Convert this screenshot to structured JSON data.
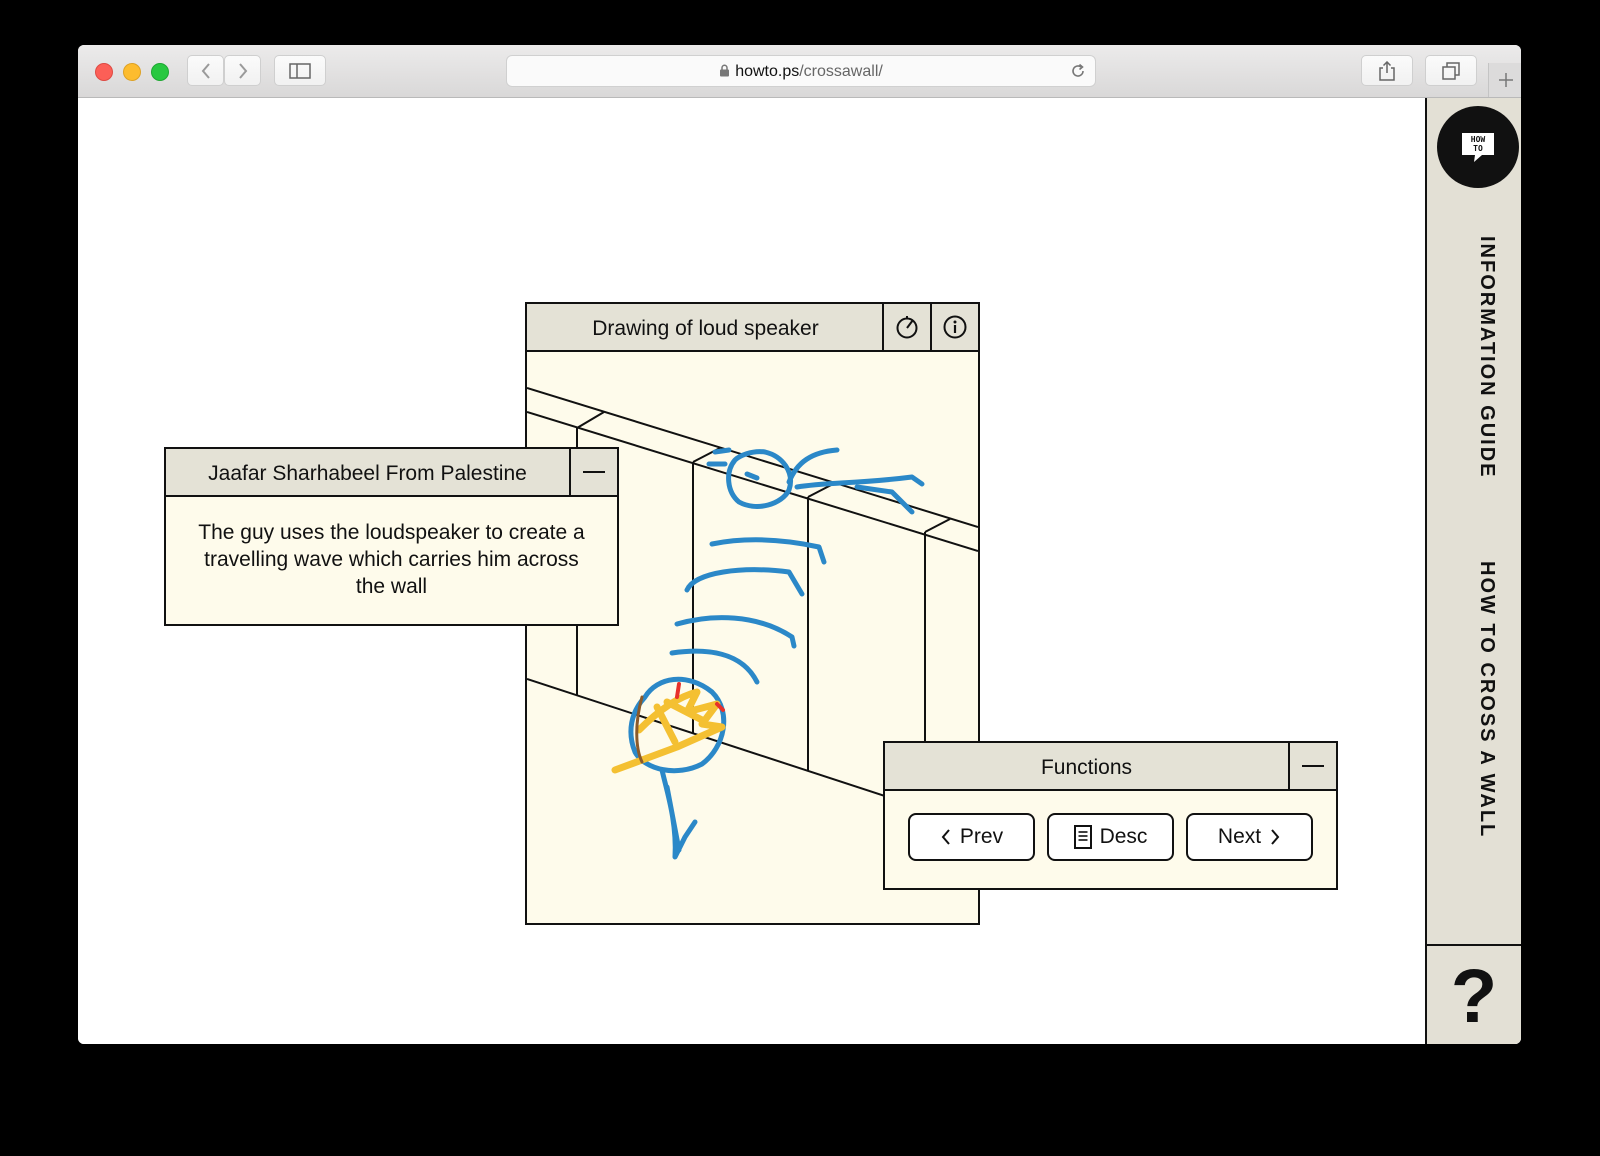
{
  "browser": {
    "url_host": "howto.ps",
    "url_path": "/crossawall/"
  },
  "sidebar": {
    "logo_text_top": "HOW",
    "logo_text_bottom": "TO",
    "link_information_guide": "INFORMATION GUIDE",
    "link_how_to_cross": "HOW TO CROSS A WALL",
    "help": "?"
  },
  "drawing_panel": {
    "title": "Drawing of loud speaker"
  },
  "author_panel": {
    "title": "Jaafar Sharhabeel From Palestine",
    "description": "The guy uses the loudspeaker to create a travelling wave which carries him across the wall"
  },
  "functions_panel": {
    "title": "Functions",
    "prev_label": "Prev",
    "desc_label": "Desc",
    "next_label": "Next"
  },
  "colors": {
    "panel_bg": "#fefbeb",
    "header_bg": "#e4e2d6",
    "sidebar_bg": "#e3e0d5",
    "drawing_blue": "#2b88c8",
    "drawing_yellow": "#f4c032",
    "drawing_red": "#e8302a"
  }
}
